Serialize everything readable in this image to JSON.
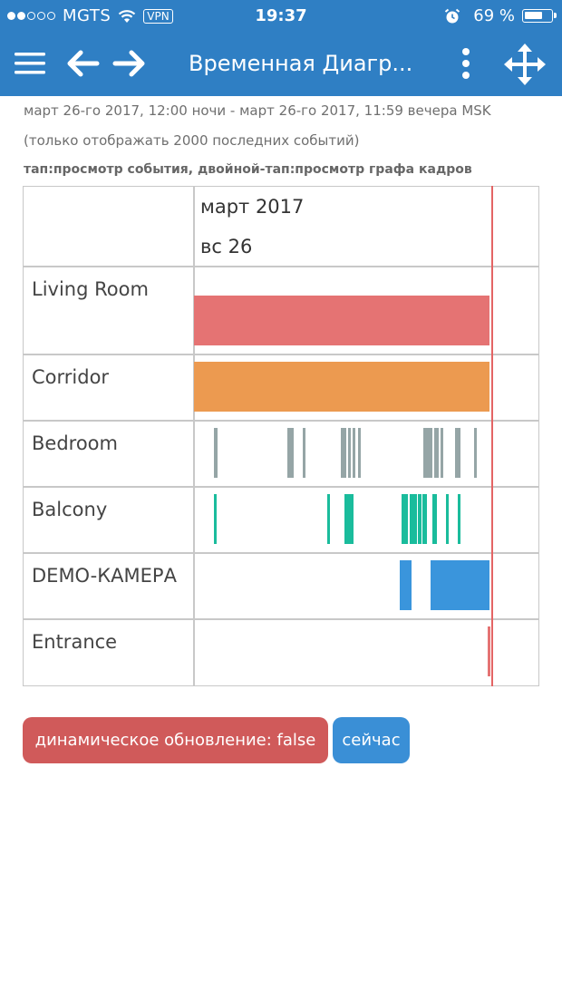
{
  "status_bar": {
    "carrier": "MGTS",
    "signal_bars_filled": 2,
    "signal_bars_total": 5,
    "vpn_label": "VPN",
    "time": "19:37",
    "battery_percent_label": "69 %",
    "battery_level": 0.69,
    "icons": [
      "signal-dots",
      "wifi-icon",
      "vpn-badge",
      "alarm-icon",
      "battery-icon"
    ]
  },
  "nav": {
    "title": "Временная Диагр...",
    "icons": [
      "menu-icon",
      "back-arrow-icon",
      "forward-arrow-icon",
      "more-vertical-icon",
      "move-arrows-icon"
    ]
  },
  "info": {
    "range": "март 26-го 2017, 12:00 ночи - март 26-го 2017, 11:59 вечера  MSK",
    "limit": "(только отображать 2000 последних событий)",
    "hint": "тап:просмотр события, двойной-тап:просмотр графа кадров"
  },
  "timeline": {
    "header_month": "март 2017",
    "header_day": "вс 26",
    "now_position": 0.86,
    "rows": [
      {
        "label": "Living Room",
        "color": "#e57373",
        "events": [
          [
            0.0,
            0.855
          ]
        ]
      },
      {
        "label": "Corridor",
        "color": "#ec9a50",
        "events": [
          [
            0.0,
            0.855
          ]
        ]
      },
      {
        "label": "Bedroom",
        "color": "#95a5a6",
        "events": [
          [
            0.058,
            0.067
          ],
          [
            0.27,
            0.29
          ],
          [
            0.315,
            0.322
          ],
          [
            0.425,
            0.44
          ],
          [
            0.445,
            0.455
          ],
          [
            0.46,
            0.468
          ],
          [
            0.475,
            0.482
          ],
          [
            0.665,
            0.69
          ],
          [
            0.695,
            0.71
          ],
          [
            0.715,
            0.72
          ],
          [
            0.755,
            0.772
          ],
          [
            0.81,
            0.818
          ]
        ]
      },
      {
        "label": "Balcony",
        "color": "#1abc9c",
        "events": [
          [
            0.058,
            0.066
          ],
          [
            0.385,
            0.392
          ],
          [
            0.435,
            0.463
          ],
          [
            0.6,
            0.62
          ],
          [
            0.625,
            0.645
          ],
          [
            0.648,
            0.66
          ],
          [
            0.662,
            0.675
          ],
          [
            0.69,
            0.704
          ],
          [
            0.73,
            0.737
          ],
          [
            0.765,
            0.772
          ]
        ]
      },
      {
        "label": "DEMO-КАМЕРА",
        "color": "#3a95dc",
        "events": [
          [
            0.595,
            0.63
          ],
          [
            0.685,
            0.855
          ]
        ]
      },
      {
        "label": "Entrance",
        "color": "#e57373",
        "events": [
          [
            0.85,
            0.857
          ]
        ]
      }
    ]
  },
  "buttons": {
    "live_update": "динамическое обновление: false",
    "now": "сейчас"
  }
}
